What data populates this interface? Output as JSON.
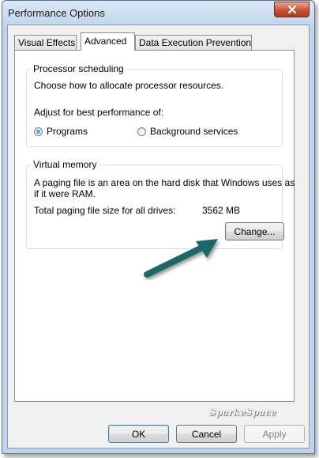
{
  "window": {
    "title": "Performance Options"
  },
  "tabs": [
    {
      "label": "Visual Effects",
      "active": false
    },
    {
      "label": "Advanced",
      "active": true
    },
    {
      "label": "Data Execution Prevention",
      "active": false
    }
  ],
  "processor": {
    "legend": "Processor scheduling",
    "description": "Choose how to allocate processor resources.",
    "adjust_label": "Adjust for best performance of:",
    "options": [
      {
        "label": "Programs",
        "selected": true
      },
      {
        "label": "Background services",
        "selected": false
      }
    ]
  },
  "virtual_memory": {
    "legend": "Virtual memory",
    "description_line1": "A paging file is an area on the hard disk that Windows uses as",
    "description_line2": "if it were RAM.",
    "total_label": "Total paging file size for all drives:",
    "total_value": "3562 MB",
    "change_button": "Change..."
  },
  "watermark": "SparkeSpace",
  "footer": {
    "ok": "OK",
    "cancel": "Cancel",
    "apply": "Apply"
  },
  "colors": {
    "arrow": "#1f6767",
    "close_button": "#c8533a"
  }
}
